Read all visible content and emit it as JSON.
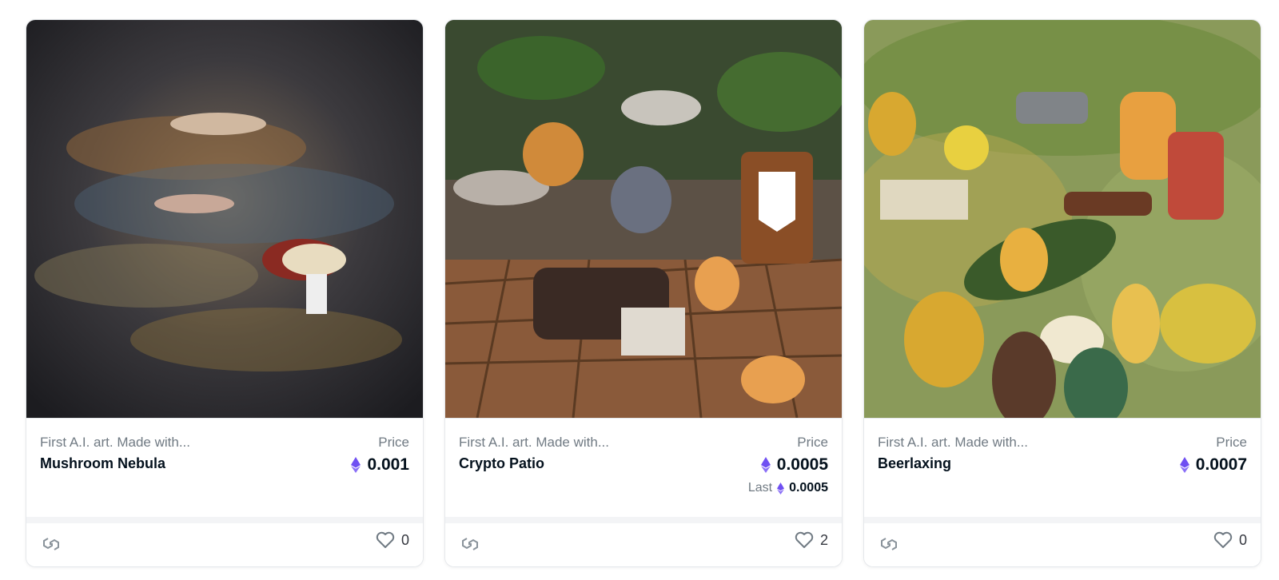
{
  "cards": [
    {
      "collection": "First A.I. art. Made with...",
      "title": "Mushroom Nebula",
      "price_label": "Price",
      "price": "0.001",
      "last_label": "",
      "last_price": "",
      "likes": "0",
      "chain_icon": "polygon-icon",
      "currency_icon": "eth-icon"
    },
    {
      "collection": "First A.I. art. Made with...",
      "title": "Crypto Patio",
      "price_label": "Price",
      "price": "0.0005",
      "last_label": "Last",
      "last_price": "0.0005",
      "likes": "2",
      "chain_icon": "polygon-icon",
      "currency_icon": "eth-icon"
    },
    {
      "collection": "First A.I. art. Made with...",
      "title": "Beerlaxing",
      "price_label": "Price",
      "price": "0.0007",
      "last_label": "",
      "last_price": "",
      "likes": "0",
      "chain_icon": "polygon-icon",
      "currency_icon": "eth-icon"
    }
  ],
  "colors": {
    "eth": "#6f4ff2",
    "text": "#04111d",
    "muted": "#707a83",
    "border": "#e5e8eb"
  }
}
